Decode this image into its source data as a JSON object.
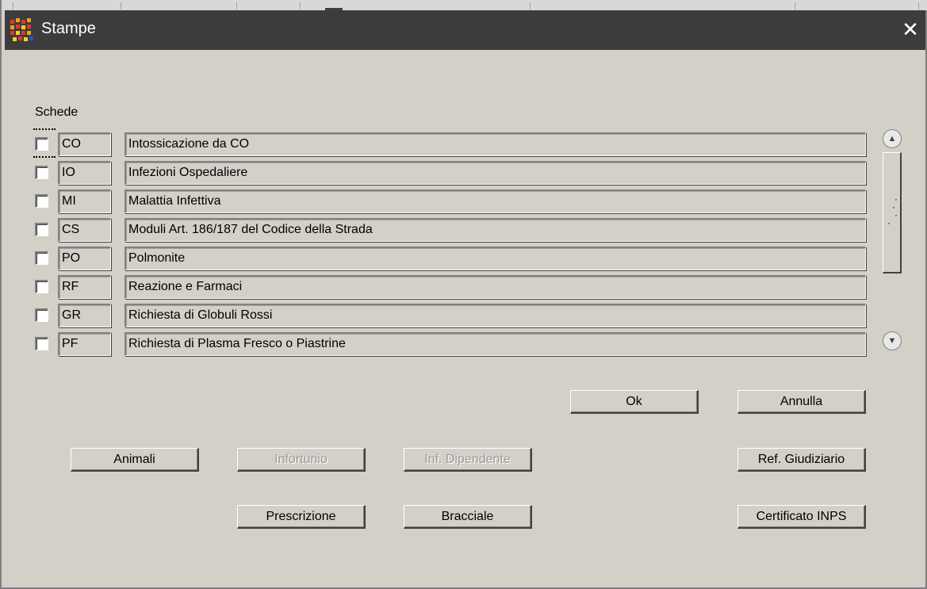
{
  "window": {
    "title": "Stampe",
    "close_glyph": "✕"
  },
  "schede": {
    "label": "Schede",
    "rows": [
      {
        "code": "CO",
        "description": "Intossicazione da CO",
        "checked": false
      },
      {
        "code": "IO",
        "description": "Infezioni Ospedaliere",
        "checked": false
      },
      {
        "code": "MI",
        "description": "Malattia Infettiva",
        "checked": false
      },
      {
        "code": "CS",
        "description": "Moduli Art. 186/187 del Codice della Strada",
        "checked": false
      },
      {
        "code": "PO",
        "description": "Polmonite",
        "checked": false
      },
      {
        "code": "RF",
        "description": "Reazione e Farmaci",
        "checked": false
      },
      {
        "code": "GR",
        "description": "Richiesta di Globuli Rossi",
        "checked": false
      },
      {
        "code": "PF",
        "description": "Richiesta di Plasma Fresco o Piastrine",
        "checked": false
      }
    ]
  },
  "scrollbar": {
    "up_glyph": "▲",
    "down_glyph": "▼"
  },
  "buttons": {
    "ok": "Ok",
    "annulla": "Annulla",
    "animali": "Animali",
    "infortunio": "Infortunio",
    "inf_dipendente": "Inf. Dipendente",
    "ref_giudiziario": "Ref. Giudiziario",
    "prescrizione": "Prescrizione",
    "bracciale": "Bracciale",
    "certificato_inps": "Certificato INPS"
  },
  "colors": {
    "window_bg": "#d4d0c8",
    "titlebar_bg": "#3c3c3c",
    "disabled_text": "#9a9a9a"
  }
}
